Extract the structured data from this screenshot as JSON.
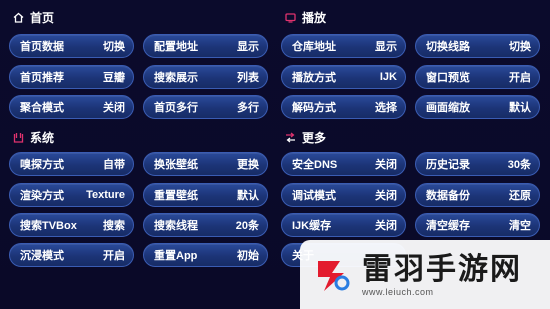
{
  "sections": {
    "home": {
      "title": "首页",
      "icon": "home-icon"
    },
    "playback": {
      "title": "播放",
      "icon": "tv-icon"
    },
    "system": {
      "title": "系统",
      "icon": "system-icon"
    },
    "more": {
      "title": "更多",
      "icon": "more-icon"
    }
  },
  "home_rows": [
    [
      {
        "label": "首页数据",
        "value": "切换"
      },
      {
        "label": "配置地址",
        "value": "显示"
      }
    ],
    [
      {
        "label": "首页推荐",
        "value": "豆瓣"
      },
      {
        "label": "搜索展示",
        "value": "列表"
      }
    ],
    [
      {
        "label": "聚合模式",
        "value": "关闭"
      },
      {
        "label": "首页多行",
        "value": "多行"
      }
    ]
  ],
  "playback_rows": [
    [
      {
        "label": "仓库地址",
        "value": "显示"
      },
      {
        "label": "切换线路",
        "value": "切换"
      }
    ],
    [
      {
        "label": "播放方式",
        "value": "IJK"
      },
      {
        "label": "窗口预览",
        "value": "开启"
      }
    ],
    [
      {
        "label": "解码方式",
        "value": "选择"
      },
      {
        "label": "画面缩放",
        "value": "默认"
      }
    ]
  ],
  "system_rows": [
    [
      {
        "label": "嗅探方式",
        "value": "自带"
      },
      {
        "label": "换张壁纸",
        "value": "更换"
      }
    ],
    [
      {
        "label": "渲染方式",
        "value": "Texture"
      },
      {
        "label": "重置壁纸",
        "value": "默认"
      }
    ],
    [
      {
        "label": "搜索TVBox",
        "value": "搜索"
      },
      {
        "label": "搜索线程",
        "value": "20条"
      }
    ],
    [
      {
        "label": "沉浸模式",
        "value": "开启"
      },
      {
        "label": "重置App",
        "value": "初始"
      }
    ]
  ],
  "more_rows": [
    [
      {
        "label": "安全DNS",
        "value": "关闭"
      },
      {
        "label": "历史记录",
        "value": "30条"
      }
    ],
    [
      {
        "label": "调试模式",
        "value": "关闭"
      },
      {
        "label": "数据备份",
        "value": "还原"
      }
    ],
    [
      {
        "label": "IJK缓存",
        "value": "关闭"
      },
      {
        "label": "清空缓存",
        "value": "清空"
      }
    ],
    [
      {
        "label": "关于",
        "value": ""
      }
    ]
  ],
  "watermark": {
    "title": "雷羽手游网",
    "url": "www.leiuch.com"
  },
  "colors": {
    "background": "#0a0a2a",
    "cell": "#1c3477",
    "cell_border": "#3a5cb3",
    "accent": "#e0326e"
  }
}
